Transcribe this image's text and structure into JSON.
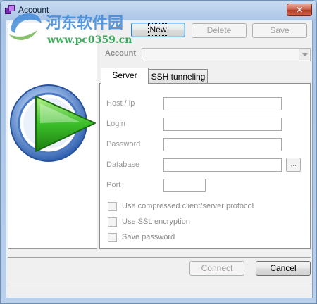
{
  "window": {
    "title": "Account",
    "close_glyph": "✕"
  },
  "toolbar": {
    "new_label": "New",
    "delete_label": "Delete",
    "save_label": "Save"
  },
  "account": {
    "label": "Account",
    "value": ""
  },
  "tabs": [
    {
      "label": "Server",
      "active": true
    },
    {
      "label": "SSH tunneling",
      "active": false
    }
  ],
  "server": {
    "fields": [
      {
        "label": "Host / ip",
        "value": ""
      },
      {
        "label": "Login",
        "value": ""
      },
      {
        "label": "Password",
        "value": ""
      },
      {
        "label": "Database",
        "value": "",
        "browse_label": "..."
      },
      {
        "label": "Port",
        "value": ""
      }
    ],
    "options": [
      {
        "label": "Use compressed client/server protocol",
        "checked": false
      },
      {
        "label": "Use SSL encryption",
        "checked": false
      },
      {
        "label": "Save password",
        "checked": false
      }
    ]
  },
  "footer": {
    "connect_label": "Connect",
    "cancel_label": "Cancel"
  },
  "watermark": {
    "site_name": "河东软件园",
    "url": "www.pc0359.cn"
  },
  "colors": {
    "title_bar": "#a9c4e6",
    "close_button": "#c75a43",
    "play_green": "#3bbf2a",
    "ring_blue": "#3a6fc4",
    "watermark_blue": "#3d88d8",
    "watermark_green": "#2ba24c"
  }
}
